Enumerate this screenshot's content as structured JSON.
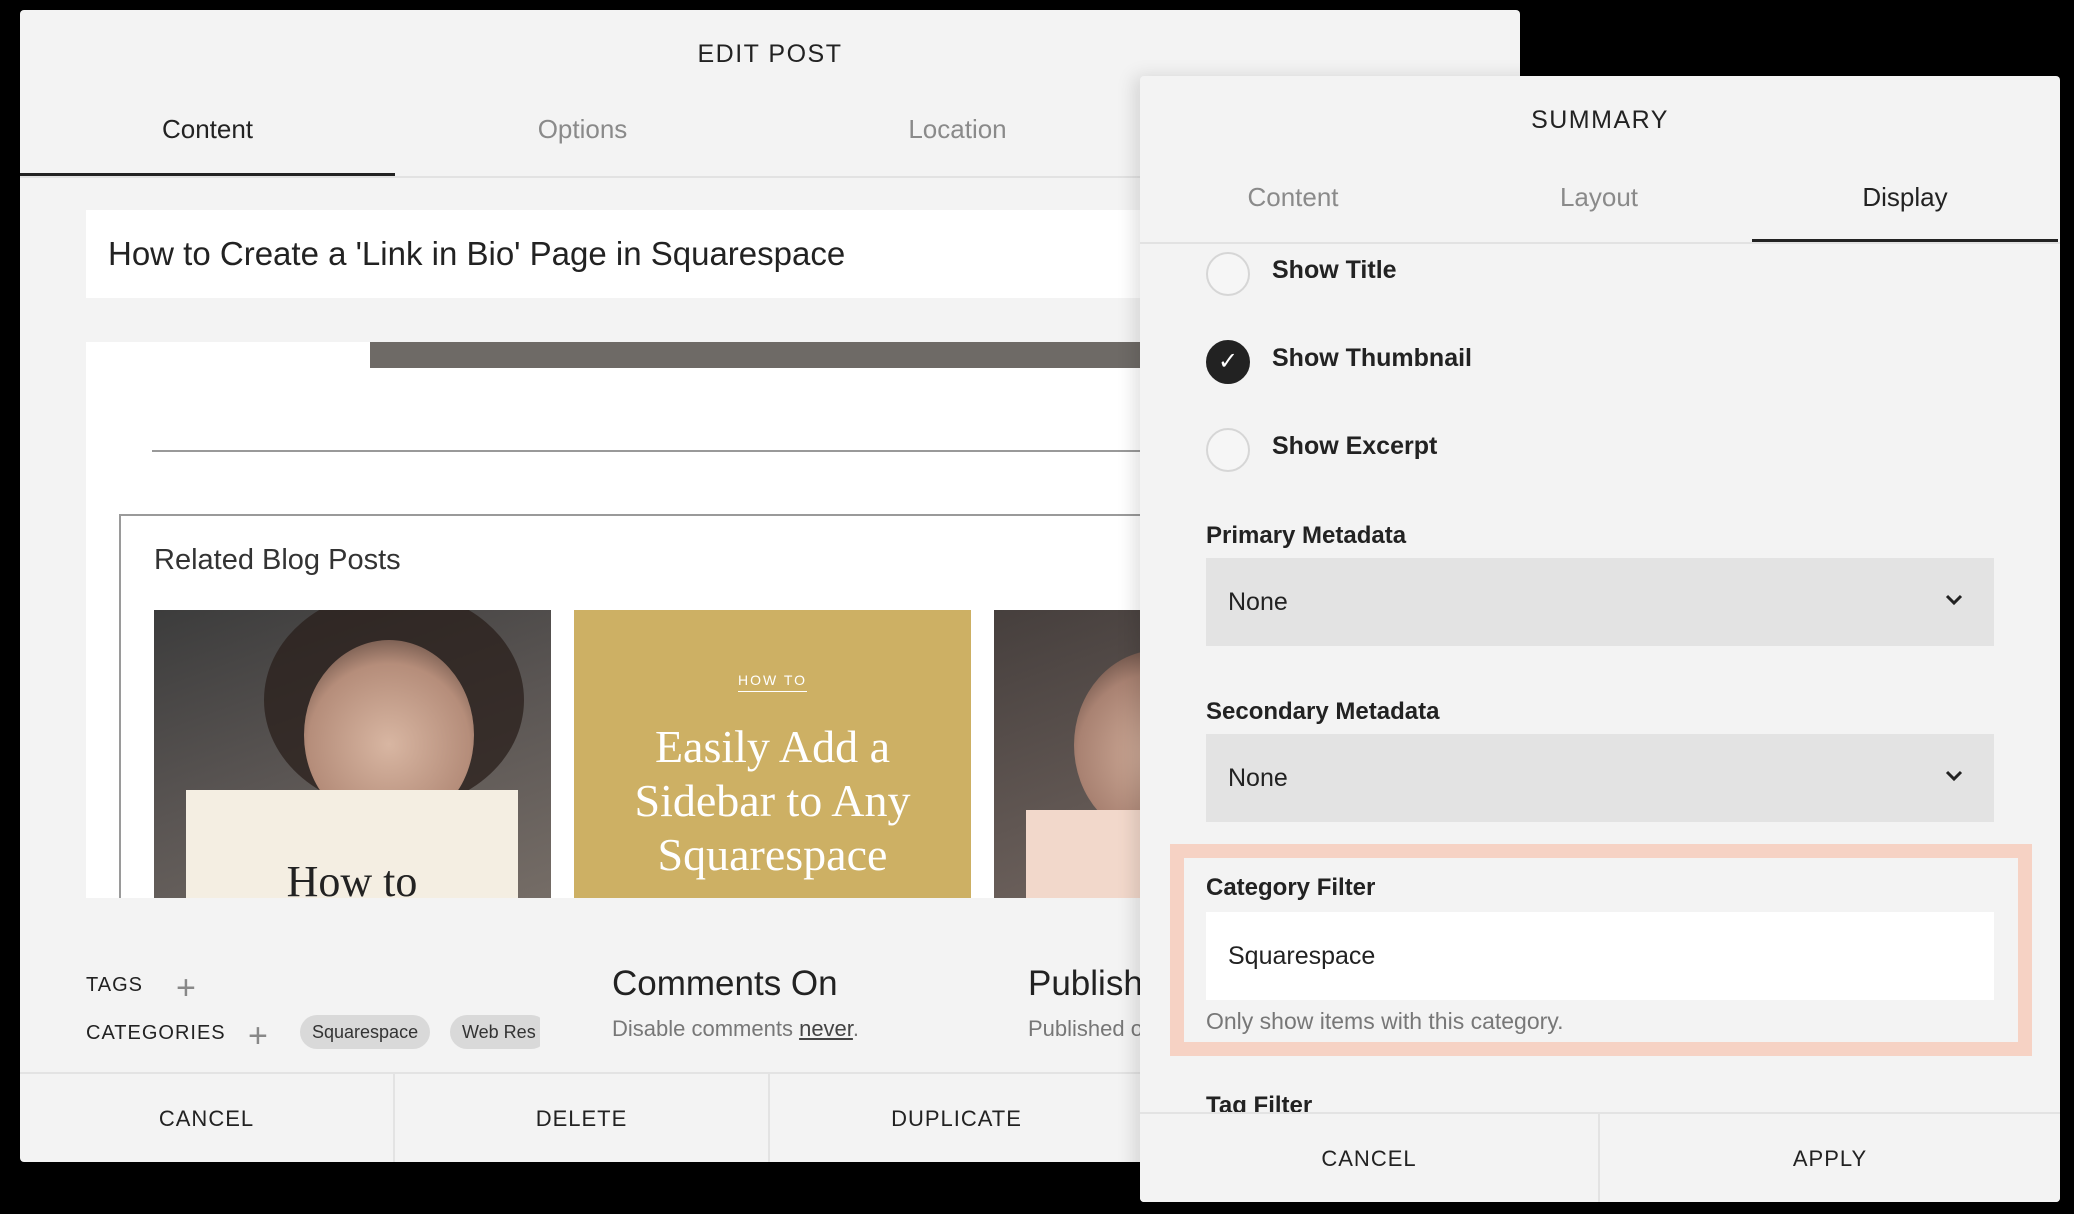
{
  "edit_post": {
    "title": "EDIT POST",
    "tabs": [
      "Content",
      "Options",
      "Location"
    ],
    "post_title": "How to Create a 'Link in Bio' Page in Squarespace",
    "related": {
      "heading": "Related Blog Posts",
      "card1_text": "How to",
      "card2_kicker": "HOW TO",
      "card2_headline": "Easily Add a Sidebar to Any Squarespace"
    },
    "tags_label": "TAGS",
    "categories_label": "CATEGORIES",
    "categories": [
      "Squarespace",
      "Web Res"
    ],
    "comments": {
      "title": "Comments On",
      "sub_prefix": "Disable comments ",
      "sub_link": "never",
      "sub_suffix": "."
    },
    "published": {
      "title": "Publishe",
      "sub": "Published o"
    },
    "footer": [
      "CANCEL",
      "DELETE",
      "DUPLICATE"
    ]
  },
  "summary": {
    "title": "SUMMARY",
    "tabs": [
      "Content",
      "Layout",
      "Display"
    ],
    "options": [
      {
        "label": "Show Title",
        "checked": false
      },
      {
        "label": "Show Thumbnail",
        "checked": true
      },
      {
        "label": "Show Excerpt",
        "checked": false
      }
    ],
    "primary_metadata": {
      "label": "Primary Metadata",
      "value": "None"
    },
    "secondary_metadata": {
      "label": "Secondary Metadata",
      "value": "None"
    },
    "category_filter": {
      "label": "Category Filter",
      "value": "Squarespace",
      "hint": "Only show items with this category."
    },
    "tag_filter_label": "Tag Filter",
    "footer": [
      "CANCEL",
      "APPLY"
    ]
  },
  "colors": {
    "highlight": "#f6d2c4",
    "card_gold": "#cdb064",
    "panel_bg": "#f3f3f3"
  }
}
